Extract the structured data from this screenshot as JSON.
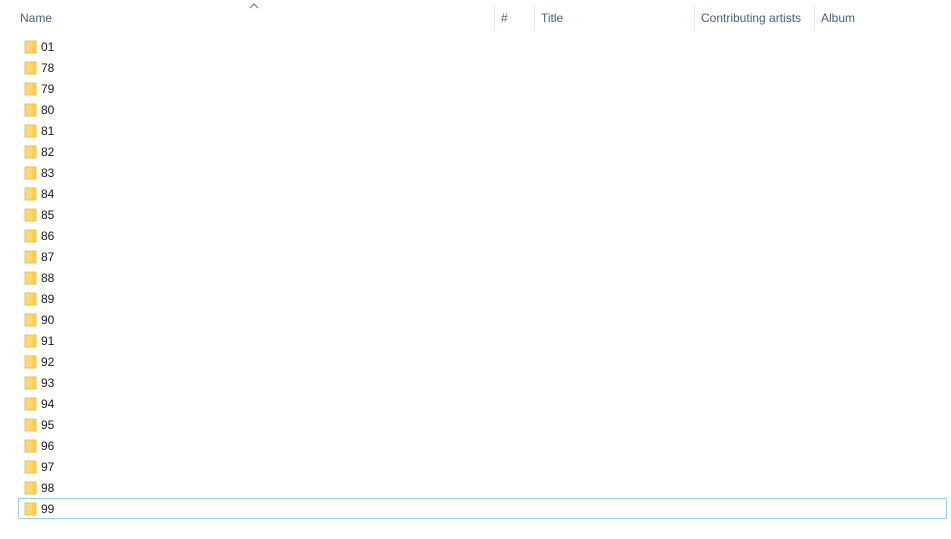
{
  "columns": {
    "name": "Name",
    "number": "#",
    "title": "Title",
    "contributing_artists": "Contributing artists",
    "album": "Album"
  },
  "sort": {
    "column": "name",
    "direction": "ascending",
    "indicator_icon": "sort-caret-up-icon"
  },
  "colors": {
    "folder_fill": "#FFD96B",
    "folder_edge": "#E3B341",
    "focus_border": "#99D1E0",
    "header_text": "#4C607A"
  },
  "rows": [
    {
      "name": "01",
      "icon": "folder-icon"
    },
    {
      "name": "78",
      "icon": "folder-icon"
    },
    {
      "name": "79",
      "icon": "folder-icon"
    },
    {
      "name": "80",
      "icon": "folder-icon"
    },
    {
      "name": "81",
      "icon": "folder-icon"
    },
    {
      "name": "82",
      "icon": "folder-icon"
    },
    {
      "name": "83",
      "icon": "folder-icon"
    },
    {
      "name": "84",
      "icon": "folder-icon"
    },
    {
      "name": "85",
      "icon": "folder-icon"
    },
    {
      "name": "86",
      "icon": "folder-icon"
    },
    {
      "name": "87",
      "icon": "folder-icon"
    },
    {
      "name": "88",
      "icon": "folder-icon"
    },
    {
      "name": "89",
      "icon": "folder-icon"
    },
    {
      "name": "90",
      "icon": "folder-icon"
    },
    {
      "name": "91",
      "icon": "folder-icon"
    },
    {
      "name": "92",
      "icon": "folder-icon"
    },
    {
      "name": "93",
      "icon": "folder-icon"
    },
    {
      "name": "94",
      "icon": "folder-icon"
    },
    {
      "name": "95",
      "icon": "folder-icon"
    },
    {
      "name": "96",
      "icon": "folder-icon"
    },
    {
      "name": "97",
      "icon": "folder-icon"
    },
    {
      "name": "98",
      "icon": "folder-icon"
    },
    {
      "name": "99",
      "icon": "folder-icon",
      "focused": true
    }
  ]
}
